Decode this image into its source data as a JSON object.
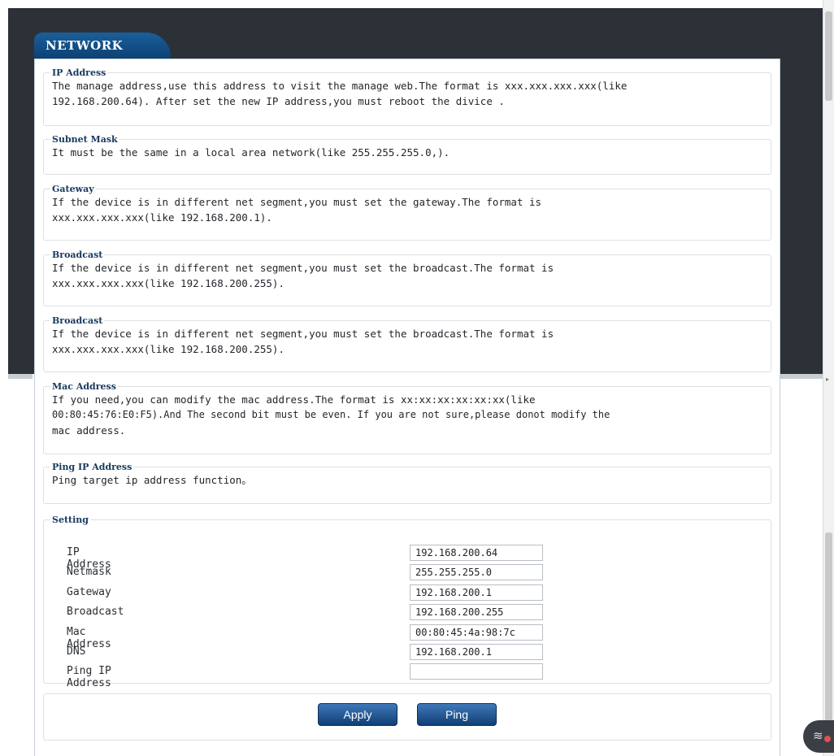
{
  "tab": {
    "title": "NETWORK"
  },
  "sections": {
    "ip_address": {
      "title": "IP Address",
      "line1": "The manage address,use this address to visit the manage web.The format is xxx.xxx.xxx.xxx(like",
      "line2": "192.168.200.64). After set the new IP address,you must reboot the divice ."
    },
    "subnet_mask": {
      "title": "Subnet Mask",
      "line1": "It must be the same in a local area network(like 255.255.255.0,)."
    },
    "gateway": {
      "title": "Gateway",
      "line1": "If the device is in different net segment,you must set the gateway.The format is",
      "line2": "xxx.xxx.xxx.xxx(like 192.168.200.1)."
    },
    "broadcast_1": {
      "title": "Broadcast",
      "line1": "If the device is in different net segment,you must set the broadcast.The format is",
      "line2": "xxx.xxx.xxx.xxx(like 192.168.200.255)."
    },
    "broadcast_2": {
      "title": "Broadcast",
      "line1": "If the device is in different net segment,you must set the broadcast.The format is",
      "line2": "xxx.xxx.xxx.xxx(like 192.168.200.255)."
    },
    "mac_address": {
      "title": "Mac Address",
      "line1": "If you need,you can modify the mac address.The format is xx:xx:xx:xx:xx:xx(like",
      "line2": "00:80:45:76:E0:F5).And The second bit must be even. If you are not sure,please donot modify the",
      "line3": "mac address."
    },
    "ping_ip": {
      "title": "Ping IP Address",
      "line1": "Ping target ip address function。"
    }
  },
  "setting": {
    "title": "Setting",
    "fields": [
      {
        "label": "IP Address",
        "value": "192.168.200.64"
      },
      {
        "label": "Netmask",
        "value": "255.255.255.0"
      },
      {
        "label": "Gateway",
        "value": "192.168.200.1"
      },
      {
        "label": "Broadcast",
        "value": "192.168.200.255"
      },
      {
        "label": "Mac Address",
        "value": "00:80:45:4a:98:7c"
      },
      {
        "label": "DNS",
        "value": "192.168.200.1"
      },
      {
        "label": "Ping IP Address",
        "value": ""
      }
    ]
  },
  "buttons": {
    "apply": "Apply",
    "ping": "Ping"
  },
  "icons": {
    "wifi": "wifi-icon"
  },
  "colors": {
    "tab": "#0b3d6e",
    "header_bg": "#2c3137",
    "legend": "#17385e",
    "button": "#103f76"
  }
}
